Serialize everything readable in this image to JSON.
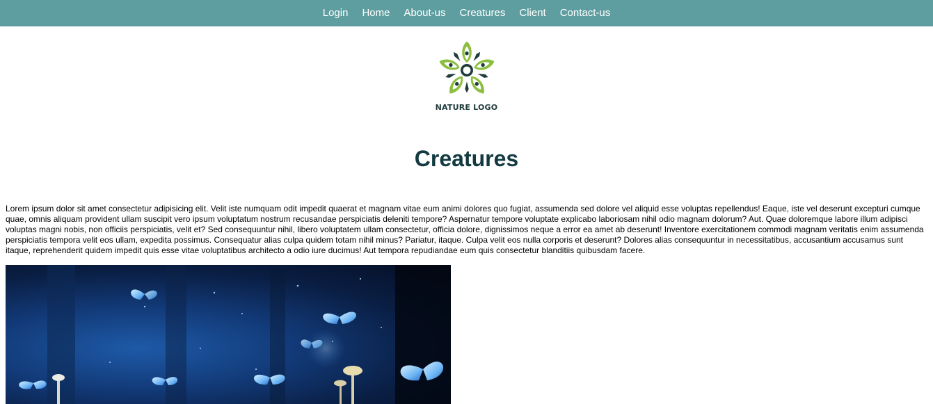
{
  "nav": {
    "items": [
      {
        "label": "Login"
      },
      {
        "label": "Home"
      },
      {
        "label": "About-us"
      },
      {
        "label": "Creatures"
      },
      {
        "label": "Client"
      },
      {
        "label": "Contact-us"
      }
    ]
  },
  "logo": {
    "text": "NATURE LOGO",
    "colors": {
      "leaf": "#8cbf3f",
      "dark": "#1f3b3a"
    }
  },
  "page": {
    "title": "Creatures",
    "paragraph": "Lorem ipsum dolor sit amet consectetur adipisicing elit. Velit iste numquam odit impedit quaerat et magnam vitae eum animi dolores quo fugiat, assumenda sed dolore vel aliquid esse voluptas repellendus! Eaque, iste vel deserunt excepturi cumque quae, omnis aliquam provident ullam suscipit vero ipsum voluptatum nostrum recusandae perspiciatis deleniti tempore? Aspernatur tempore voluptate explicabo laboriosam nihil odio magnam dolorum? Aut. Quae doloremque labore illum adipisci voluptas magni nobis, non officiis perspiciatis, velit et? Sed consequuntur nihil, libero voluptatem ullam consectetur, officia dolore, dignissimos neque a error ea amet ab deserunt! Inventore exercitationem commodi magnam veritatis enim assumenda perspiciatis tempora velit eos ullam, expedita possimus. Consequatur alias culpa quidem totam nihil minus? Pariatur, itaque. Culpa velit eos nulla corporis et deserunt? Dolores alias consequuntur in necessitatibus, accusantium accusamus sunt itaque, reprehenderit quidem impedit quis esse vitae voluptatibus architecto a odio iure ducimus! Aut tempora repudiandae eum quis consectetur blanditiis quibusdam facere."
  },
  "colors": {
    "navbar": "#5f9ea0",
    "title": "#123a40"
  },
  "hero": {
    "subject": "blue butterflies and mushrooms in forest"
  }
}
